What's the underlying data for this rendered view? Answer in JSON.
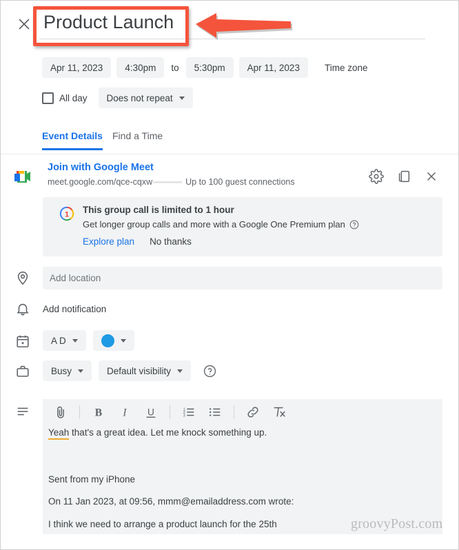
{
  "header": {
    "close_icon": "close-icon",
    "title_value": "Product Launch"
  },
  "annotation": {
    "type": "red-rectangle-and-arrow",
    "color": "#f4543c",
    "target": "event-title-field"
  },
  "schedule": {
    "start_date": "Apr 11, 2023",
    "start_time": "4:30pm",
    "to_label": "to",
    "end_time": "5:30pm",
    "end_date": "Apr 11, 2023",
    "timezone_label": "Time zone",
    "all_day_label": "All day",
    "all_day_checked": false,
    "repeat_label": "Does not repeat"
  },
  "tabs": [
    {
      "label": "Event Details",
      "active": true
    },
    {
      "label": "Find a Time",
      "active": false
    }
  ],
  "meet": {
    "icon": "google-meet-icon",
    "join_label": "Join with Google Meet",
    "url": "meet.google.com/qce-cqxw",
    "guest_note": "Up to 100 guest connections",
    "settings_icon": "gear-icon",
    "copy_icon": "copy-icon",
    "remove_icon": "close-icon"
  },
  "promo": {
    "logo": "google-one-icon",
    "title": "This group call is limited to 1 hour",
    "subtitle": "Get longer group calls and more with a Google One Premium plan",
    "help_icon": "help-circle-icon",
    "primary_action": "Explore plan",
    "secondary_action": "No thanks"
  },
  "location": {
    "icon": "location-pin-icon",
    "placeholder": "Add location",
    "value": ""
  },
  "notification": {
    "icon": "bell-icon",
    "label": "Add notification"
  },
  "calendar": {
    "icon": "calendar-icon",
    "owner_label": "A D",
    "color_hex": "#1e9ae5",
    "color_name": "color-swatch"
  },
  "availability": {
    "icon": "briefcase-icon",
    "busy_label": "Busy",
    "visibility_label": "Default visibility",
    "help_icon": "help-circle-icon"
  },
  "description": {
    "icon": "description-lines-icon",
    "toolbar": [
      {
        "name": "attach-icon",
        "label": "Attach"
      },
      {
        "name": "bold-icon",
        "label": "B"
      },
      {
        "name": "italic-icon",
        "label": "I"
      },
      {
        "name": "underline-icon",
        "label": "U"
      },
      {
        "name": "numbered-list-icon",
        "label": "Numbered list"
      },
      {
        "name": "bulleted-list-icon",
        "label": "Bulleted list"
      },
      {
        "name": "link-icon",
        "label": "Link"
      },
      {
        "name": "remove-formatting-icon",
        "label": "Remove formatting"
      }
    ],
    "line1_spell": "Yeah",
    "line1_rest": " that's a great idea. Let me knock something up.",
    "line2": "Sent from my iPhone",
    "line3": "On 11 Jan 2023, at 09:56, mmm@emailaddress.com wrote:",
    "line4": "I think we need to arrange a product launch for the 25th"
  },
  "watermark": {
    "text": "groovyPost.com"
  }
}
